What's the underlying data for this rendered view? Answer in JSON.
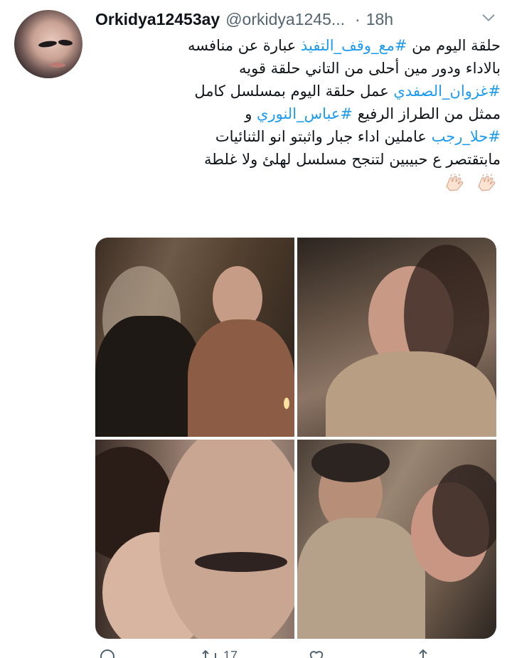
{
  "tweet": {
    "display_name": "Orkidya12453ay",
    "handle": "@orkidya1245...",
    "separator": "·",
    "time": "18h",
    "text": {
      "line1_pre": "حلقة اليوم من ",
      "line1_hashtag": "#مع_وقف_التفيذ",
      "line1_post": " عبارة عن منافسه",
      "line2": "بالاداء ودور مين أحلى من التاني حلقة قويه",
      "line3_hashtag": "#غزوان_الصفدي",
      "line3_post": " عمل حلقة اليوم بمسلسل كامل",
      "line4_pre": "ممثل من الطراز الرفيع ",
      "line4_hashtag": "#عباس_النوري",
      "line4_post": " و",
      "line5_hashtag": "#حلا_رجب",
      "line5_post": " عاملين اداء جبار واثبتو انو الثنائيات",
      "line6": "مابتقتصر ع حبيبين لتنجح  مسلسل لهلئ ولا غلطة"
    },
    "emoji": [
      "clapping-hands",
      "clapping-hands"
    ],
    "media_count": 4,
    "actions": {
      "reply_count": "",
      "retweet_count": "17",
      "like_count": "",
      "share_count": ""
    }
  },
  "colors": {
    "link": "#1d9bf0",
    "secondary": "#536471",
    "text": "#0f1419"
  }
}
